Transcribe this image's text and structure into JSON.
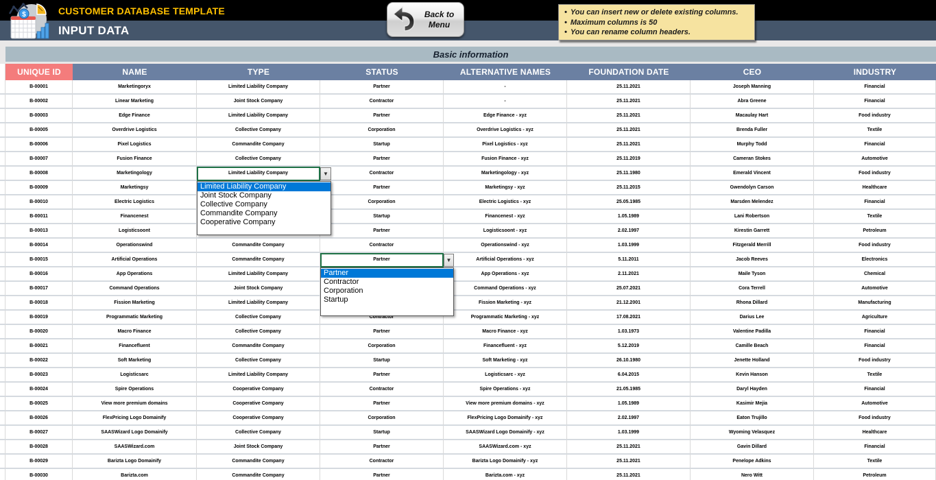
{
  "colors": {
    "page_bg": "#E9E8E8",
    "topbar_bg": "#000000",
    "title_gold": "#FFC000",
    "subbar_bg": "#45566B",
    "band_bg": "#A9BAC3",
    "band_text": "#16202E",
    "header_bg": "#6B80A2",
    "unique_id_header_bg": "#F47C7C",
    "header_text": "#FFFFFF",
    "row_bg": "#FFFFFF",
    "grid_line": "#D9D9D9",
    "row_separator": "#D5DAE0",
    "cell_text": "#000000",
    "select_border_green": "#1E7145",
    "highlight_blue": "#0078D7",
    "note_bg": "#F6E3A0"
  },
  "header": {
    "title": "CUSTOMER DATABASE TEMPLATE",
    "subtitle": "INPUT DATA",
    "logo_icon": "chart-calculator-logo",
    "back_button": {
      "line1": "Back to",
      "line2": "Menu",
      "icon": "back-arrow-icon"
    },
    "notes": [
      "You can insert new or delete existing columns.",
      "Maximum columns is 50",
      "You can rename column headers."
    ]
  },
  "section": {
    "band_label": "Basic information"
  },
  "table": {
    "columns": [
      {
        "key": "unique_id",
        "label": "UNIQUE ID"
      },
      {
        "key": "name",
        "label": "NAME"
      },
      {
        "key": "type",
        "label": "TYPE"
      },
      {
        "key": "status",
        "label": "STATUS"
      },
      {
        "key": "alternative_names",
        "label": "ALTERNATIVE NAMES"
      },
      {
        "key": "foundation_date",
        "label": "FOUNDATION DATE"
      },
      {
        "key": "ceo",
        "label": "CEO"
      },
      {
        "key": "industry",
        "label": "INDUSTRY"
      }
    ],
    "rows": [
      [
        "B-00001",
        "Marketingoryx",
        "Limited Liability Company",
        "Partner",
        "-",
        "25.11.2021",
        "Joseph Manning",
        "Financial"
      ],
      [
        "B-00002",
        "Linear Marketing",
        "Joint Stock Company",
        "Contractor",
        "-",
        "25.11.2021",
        "Abra Greene",
        "Financial"
      ],
      [
        "B-00003",
        "Edge Finance",
        "Limited Liability Company",
        "Partner",
        "Edge Finance - xyz",
        "25.11.2021",
        "Macaulay Hart",
        "Food industry"
      ],
      [
        "B-00005",
        "Overdrive Logistics",
        "Collective Company",
        "Corporation",
        "Overdrive Logistics - xyz",
        "25.11.2021",
        "Brenda Fuller",
        "Textile"
      ],
      [
        "B-00006",
        "Pixel Logistics",
        "Commandite Company",
        "Startup",
        "Pixel Logistics - xyz",
        "25.11.2021",
        "Murphy Todd",
        "Financial"
      ],
      [
        "B-00007",
        "Fusion Finance",
        "Collective Company",
        "Partner",
        "Fusion Finance - xyz",
        "25.11.2019",
        "Cameran Stokes",
        "Automotive"
      ],
      [
        "B-00008",
        "Marketingology",
        "Limited Liability Company",
        "Contractor",
        "Marketingology - xyz",
        "25.11.1980",
        "Emerald Vincent",
        "Food industry"
      ],
      [
        "B-00009",
        "Marketingsy",
        "",
        "Partner",
        "Marketingsy - xyz",
        "25.11.2015",
        "Gwendolyn Carson",
        "Healthcare"
      ],
      [
        "B-00010",
        "Electric Logistics",
        "",
        "Corporation",
        "Electric Logistics - xyz",
        "25.05.1985",
        "Marsden Melendez",
        "Financial"
      ],
      [
        "B-00011",
        "Financenest",
        "",
        "Startup",
        "Financenest - xyz",
        "1.05.1989",
        "Lani Robertson",
        "Textile"
      ],
      [
        "B-00013",
        "Logisticsoont",
        "",
        "Partner",
        "Logisticsoont - xyz",
        "2.02.1997",
        "Kirestin Garrett",
        "Petroleum"
      ],
      [
        "B-00014",
        "Operationswind",
        "Commandite Company",
        "Contractor",
        "Operationswind - xyz",
        "1.03.1999",
        "Fitzgerald Merrill",
        "Food industry"
      ],
      [
        "B-00015",
        "Artificial Operations",
        "Commandite Company",
        "Partner",
        "Artificial Operations - xyz",
        "5.11.2011",
        "Jacob Reeves",
        "Electronics"
      ],
      [
        "B-00016",
        "App Operations",
        "Limited Liability Company",
        "",
        "App Operations - xyz",
        "2.11.2021",
        "Maile Tyson",
        "Chemical"
      ],
      [
        "B-00017",
        "Command Operations",
        "Joint Stock Company",
        "",
        "Command Operations - xyz",
        "25.07.2021",
        "Cora Terrell",
        "Automotive"
      ],
      [
        "B-00018",
        "Fission Marketing",
        "Limited Liability Company",
        "",
        "Fission Marketing - xyz",
        "21.12.2001",
        "Rhona Dillard",
        "Manufacturing"
      ],
      [
        "B-00019",
        "Programmatic Marketing",
        "Collective Company",
        "Contractor",
        "Programmatic Marketing - xyz",
        "17.08.2021",
        "Darius Lee",
        "Agriculture"
      ],
      [
        "B-00020",
        "Macro Finance",
        "Collective Company",
        "Partner",
        "Macro Finance - xyz",
        "1.03.1973",
        "Valentine Padilla",
        "Financial"
      ],
      [
        "B-00021",
        "Financefluent",
        "Commandite Company",
        "Corporation",
        "Financefluent - xyz",
        "5.12.2019",
        "Camille Beach",
        "Financial"
      ],
      [
        "B-00022",
        "Soft Marketing",
        "Collective Company",
        "Startup",
        "Soft Marketing - xyz",
        "26.10.1980",
        "Jenette Holland",
        "Food industry"
      ],
      [
        "B-00023",
        "Logisticsarc",
        "Limited Liability Company",
        "Partner",
        "Logisticsarc - xyz",
        "6.04.2015",
        "Kevin Hanson",
        "Textile"
      ],
      [
        "B-00024",
        "Spire Operations",
        "Cooperative Company",
        "Contractor",
        "Spire Operations - xyz",
        "21.05.1985",
        "Daryl Hayden",
        "Financial"
      ],
      [
        "B-00025",
        "View more premium domains",
        "Cooperative Company",
        "Partner",
        "View more premium domains - xyz",
        "1.05.1989",
        "Kasimir Mejia",
        "Automotive"
      ],
      [
        "B-00026",
        "FlexPricing Logo Domainify",
        "Cooperative Company",
        "Corporation",
        "FlexPricing Logo Domainify - xyz",
        "2.02.1997",
        "Eaton Trujillo",
        "Food industry"
      ],
      [
        "B-00027",
        "SAASWizard Logo Domainify",
        "Collective Company",
        "Startup",
        "SAASWizard Logo Domainify - xyz",
        "1.03.1999",
        "Wyoming Velasquez",
        "Healthcare"
      ],
      [
        "B-00028",
        "SAASWizard.com",
        "Joint Stock Company",
        "Partner",
        "SAASWizard.com - xyz",
        "25.11.2021",
        "Gavin Dillard",
        "Financial"
      ],
      [
        "B-00029",
        "Barizta Logo Domainify",
        "Commandite Company",
        "Contractor",
        "Barizta Logo Domainify - xyz",
        "25.11.2021",
        "Penelope Adkins",
        "Textile"
      ],
      [
        "B-00030",
        "Barizta.com",
        "Commandite Company",
        "Partner",
        "Barizta.com - xyz",
        "25.11.2021",
        "Nero Witt",
        "Petroleum"
      ]
    ]
  },
  "dropdowns": {
    "type": {
      "row_id": "B-00008",
      "selected": "Limited Liability Company",
      "options": [
        "Limited Liability Company",
        "Joint Stock Company",
        "Collective Company",
        "Commandite Company",
        "Cooperative Company"
      ],
      "highlighted_index": 0
    },
    "status": {
      "row_id": "B-00015",
      "selected": "Partner",
      "options": [
        "Partner",
        "Contractor",
        "Corporation",
        "Startup"
      ],
      "highlighted_index": 0
    }
  }
}
